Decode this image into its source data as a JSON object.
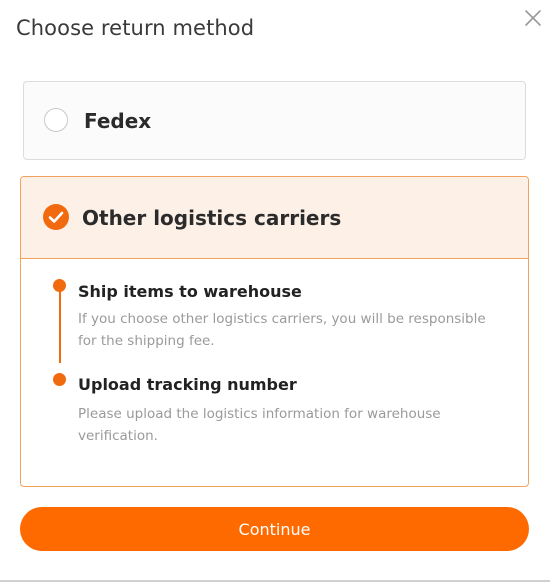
{
  "dialog": {
    "title": "Choose return method",
    "close_icon": "close-icon"
  },
  "options": [
    {
      "label": "Fedex",
      "selected": false
    },
    {
      "label": "Other logistics carriers",
      "selected": true,
      "steps": [
        {
          "title": "Ship items to warehouse",
          "description": "If you choose other logistics carriers, you will be responsible for the shipping fee."
        },
        {
          "title": "Upload tracking number",
          "description": "Please upload the logistics information for warehouse verification."
        }
      ]
    }
  ],
  "continue_label": "Continue",
  "colors": {
    "accent": "#ff6a00",
    "selected_bg": "#fdf0e6",
    "selected_border": "#f2a35c"
  }
}
